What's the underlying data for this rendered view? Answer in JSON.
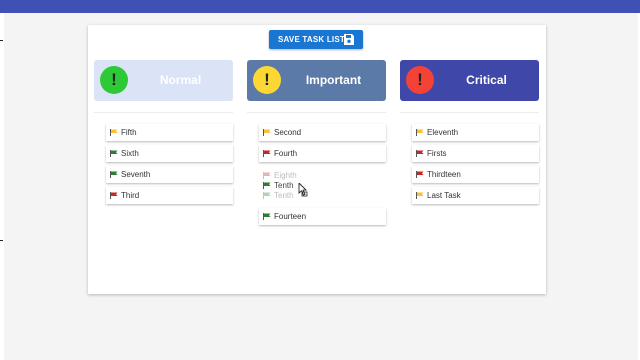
{
  "toolbar": {
    "save_label": "SAVE TASK LIST"
  },
  "colors": {
    "topbar": "#3f51b5",
    "save_button": "#1976d2",
    "flag_yellow": "#fbc02d",
    "flag_green": "#2e7d32",
    "flag_red": "#c62828"
  },
  "columns": [
    {
      "title": "Normal",
      "icon": "exclamation-icon",
      "header_bg": "#dbe3f6",
      "icon_bg": "#2dc937",
      "items": [
        {
          "label": "Fifth",
          "flag": "yellow"
        },
        {
          "label": "Sixth",
          "flag": "green"
        },
        {
          "label": "Seventh",
          "flag": "green"
        },
        {
          "label": "Third",
          "flag": "red"
        }
      ]
    },
    {
      "title": "Important",
      "icon": "exclamation-icon",
      "header_bg": "#5c7aa8",
      "icon_bg": "#fdd835",
      "items": [
        {
          "label": "Second",
          "flag": "yellow"
        },
        {
          "label": "Fourth",
          "flag": "red"
        },
        {
          "label": "Eighth",
          "flag": "red"
        },
        {
          "label": "Tenth",
          "flag": "green"
        },
        {
          "label": "Fourteen",
          "flag": "green"
        }
      ],
      "dragging": {
        "label": "Tenth",
        "flag": "green"
      }
    },
    {
      "title": "Critical",
      "icon": "exclamation-icon",
      "header_bg": "#3f47a8",
      "icon_bg": "#f44336",
      "items": [
        {
          "label": "Eleventh",
          "flag": "yellow"
        },
        {
          "label": "Firsts",
          "flag": "red"
        },
        {
          "label": "Thirdteen",
          "flag": "red"
        },
        {
          "label": "Last Task",
          "flag": "yellow"
        }
      ]
    }
  ]
}
